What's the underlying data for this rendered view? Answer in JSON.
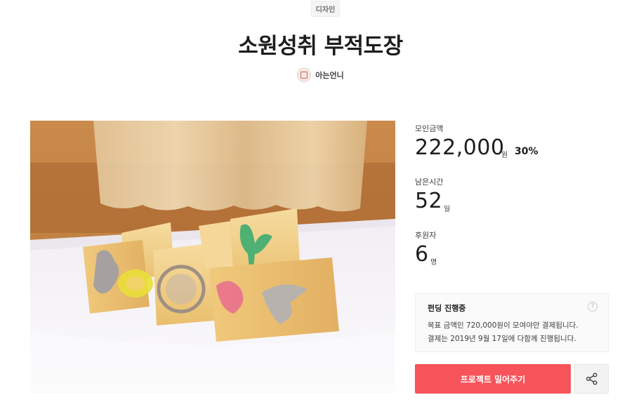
{
  "project": {
    "category": "디자인",
    "title": "소원성취 부적도장",
    "creator": "아는언니"
  },
  "stats": {
    "funded_label": "모인금액",
    "funded_value": "222,000",
    "funded_unit": "원",
    "funded_percent": "30%",
    "remaining_label": "남은시간",
    "remaining_value": "52",
    "remaining_unit": "일",
    "backers_label": "후원자",
    "backers_value": "6",
    "backers_unit": "명"
  },
  "notice": {
    "title": "펀딩 진행중",
    "line1": "목표 금액인 720,000원이 모여야만 결제됩니다.",
    "line2": "결제는 2019년 9월 17일에 다함께 진행됩니다.",
    "help_icon": "question-icon"
  },
  "actions": {
    "support_label": "프로젝트 밀어주기",
    "share_icon": "share-icon"
  },
  "colors": {
    "accent": "#f7535b",
    "text": "#1d1d1d"
  }
}
